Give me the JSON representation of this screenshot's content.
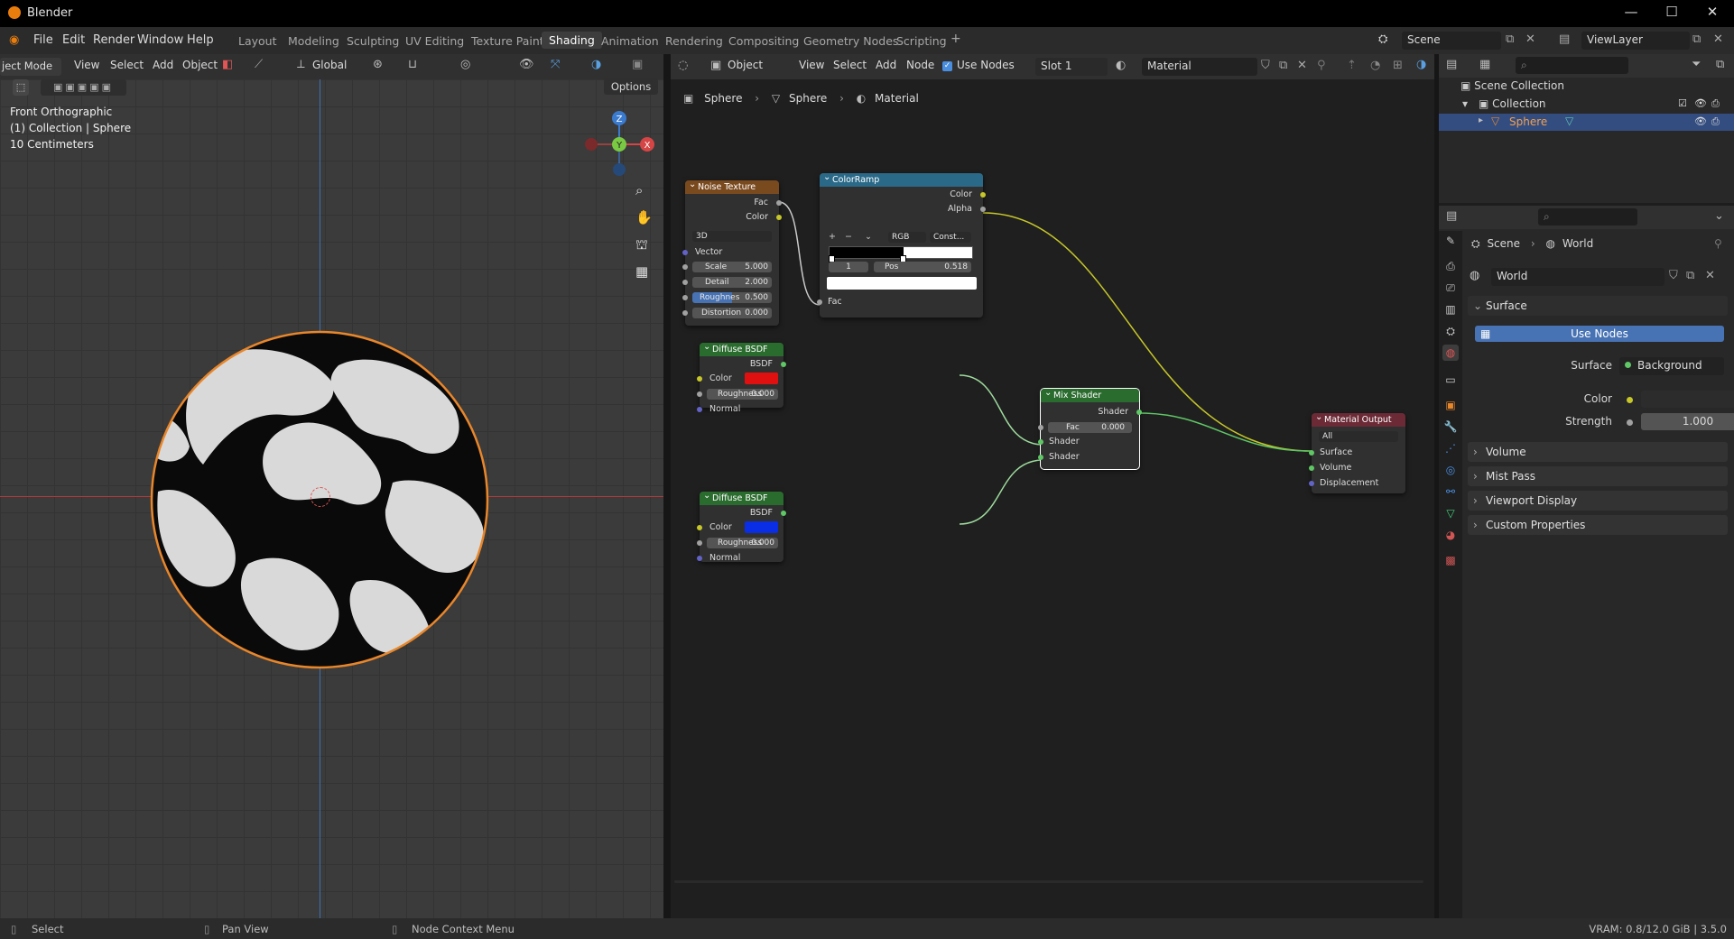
{
  "window": {
    "title": "Blender",
    "controls": [
      "—",
      "☐",
      "✕"
    ]
  },
  "menubar": {
    "menus": [
      "File",
      "Edit",
      "Render",
      "Window",
      "Help"
    ],
    "workspaces": [
      "Layout",
      "Modeling",
      "Sculpting",
      "UV Editing",
      "Texture Paint",
      "Shading",
      "Animation",
      "Rendering",
      "Compositing",
      "Geometry Nodes",
      "Scripting"
    ],
    "active_workspace": "Shading",
    "add_workspace": "+",
    "scene_name": "Scene",
    "viewlayer_name": "ViewLayer"
  },
  "viewport": {
    "mode": "ject Mode",
    "menus": [
      "View",
      "Select",
      "Add",
      "Object"
    ],
    "orientation": "Global",
    "options_label": "Options",
    "overlay_lines": [
      "Front Orthographic",
      "(1) Collection | Sphere",
      "10 Centimeters"
    ],
    "gizmo_axes": {
      "z": "Z",
      "y": "Y",
      "x": "X"
    },
    "colors": {
      "x_axis": "#d64545",
      "y_axis": "#3fa0e0",
      "z_axis": "#3a7bcf",
      "selection": "#e8862a"
    }
  },
  "node_editor": {
    "object_label": "Object",
    "menus": [
      "View",
      "Select",
      "Add",
      "Node"
    ],
    "use_nodes_label": "Use Nodes",
    "slot_label": "Slot 1",
    "material_name": "Material",
    "breadcrumb": [
      "Sphere",
      "Sphere",
      "Material"
    ],
    "nodes": {
      "noise": {
        "title": "Noise Texture",
        "out_fac": "Fac",
        "out_color": "Color",
        "dim": "3D",
        "vector": "Vector",
        "fields": [
          {
            "label": "Scale",
            "value": "5.000"
          },
          {
            "label": "Detail",
            "value": "2.000"
          },
          {
            "label": "Roughnes",
            "value": "0.500"
          },
          {
            "label": "Distortion",
            "value": "0.000"
          }
        ],
        "header_color": "#7a4a1f"
      },
      "colorramp": {
        "title": "ColorRamp",
        "out_color": "Color",
        "out_alpha": "Alpha",
        "mode": "RGB",
        "interp": "Const...",
        "index": "1",
        "pos_label": "Pos",
        "pos_value": "0.518",
        "in_fac": "Fac",
        "header_color": "#2a6a88"
      },
      "diffuse1": {
        "title": "Diffuse BSDF",
        "out": "BSDF",
        "color_label": "Color",
        "roughness_label": "Roughness",
        "roughness_value": "0.000",
        "normal": "Normal",
        "swatch": "#e01010",
        "header_color": "#2a6b2e"
      },
      "diffuse2": {
        "title": "Diffuse BSDF",
        "out": "BSDF",
        "color_label": "Color",
        "roughness_label": "Roughness",
        "roughness_value": "0.000",
        "normal": "Normal",
        "swatch": "#0a2ee6",
        "header_color": "#2a6b2e"
      },
      "mix": {
        "title": "Mix Shader",
        "out": "Shader",
        "fac_label": "Fac",
        "fac_value": "0.000",
        "in1": "Shader",
        "in2": "Shader",
        "header_color": "#2a6b2e"
      },
      "output": {
        "title": "Material Output",
        "target": "All",
        "in_surface": "Surface",
        "in_volume": "Volume",
        "in_displacement": "Displacement",
        "header_color": "#6b2a36"
      }
    }
  },
  "outliner": {
    "items": [
      {
        "label": "Scene Collection"
      },
      {
        "label": "Collection"
      },
      {
        "label": "Sphere"
      }
    ]
  },
  "properties": {
    "breadcrumb": [
      "Scene",
      "World"
    ],
    "world_name": "World",
    "surface_panel": "Surface",
    "use_nodes_button": "Use Nodes",
    "surface_label": "Surface",
    "surface_value": "Background",
    "color_label": "Color",
    "strength_label": "Strength",
    "strength_value": "1.000",
    "panels": [
      "Volume",
      "Mist Pass",
      "Viewport Display",
      "Custom Properties"
    ]
  },
  "statusbar": {
    "select": "Select",
    "pan": "Pan View",
    "context": "Node Context Menu",
    "vram": "VRAM: 0.8/12.0 GiB | 3.5.0"
  }
}
